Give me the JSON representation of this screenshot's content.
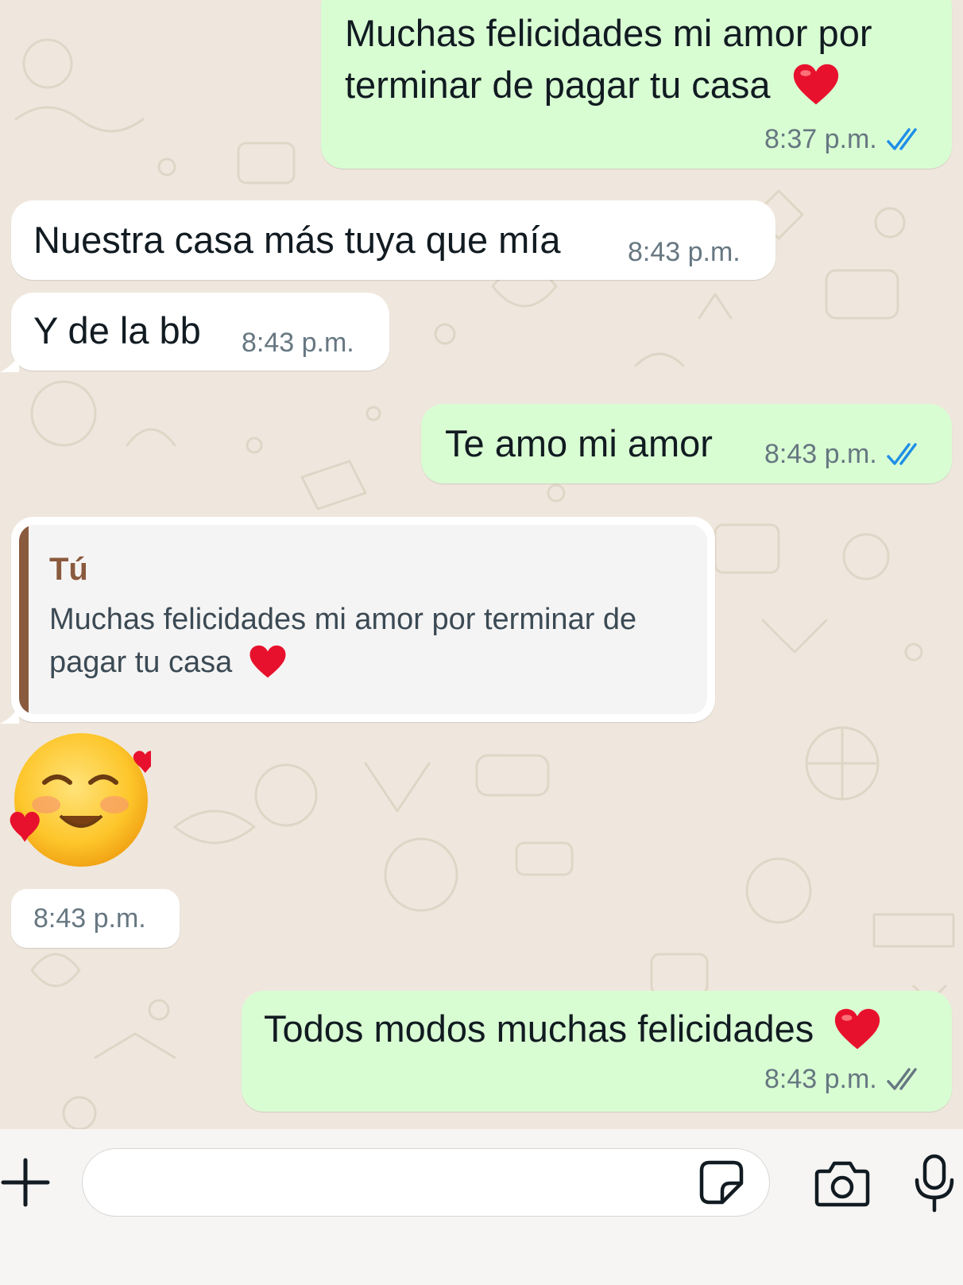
{
  "colors": {
    "outgoing_bubble": "#d9fdd3",
    "incoming_bubble": "#ffffff",
    "read_ticks": "#1f8fe6",
    "delivered_ticks": "#667781",
    "quote_bar": "#8a5a3e",
    "quote_author": "#8a5a3e"
  },
  "messages": [
    {
      "direction": "outgoing",
      "line1": "Muchas felicidades mi amor por",
      "line2": "terminar de pagar tu casa",
      "emoji": "red-heart",
      "time": "8:37 p.m.",
      "status": "read"
    },
    {
      "direction": "incoming",
      "text": "Nuestra casa más tuya que mía",
      "time": "8:43 p.m."
    },
    {
      "direction": "incoming",
      "text": "Y de la bb",
      "time": "8:43 p.m."
    },
    {
      "direction": "outgoing",
      "text": "Te amo mi amor",
      "time": "8:43 p.m.",
      "status": "read"
    },
    {
      "direction": "incoming",
      "type": "quote",
      "quote": {
        "author": "Tú",
        "line1": "Muchas felicidades mi amor por terminar de",
        "line2": "pagar tu casa",
        "emoji": "red-heart"
      }
    },
    {
      "direction": "incoming",
      "type": "sticker-emoji",
      "emoji": "smiling-face-with-hearts",
      "time": "8:43 p.m."
    },
    {
      "direction": "outgoing",
      "text": "Todos modos muchas felicidades",
      "emoji": "red-heart",
      "time": "8:43 p.m.",
      "status": "delivered"
    }
  ],
  "composer": {
    "input_value": "",
    "icons": [
      "plus-icon",
      "sticker-icon",
      "camera-icon",
      "microphone-icon"
    ]
  }
}
